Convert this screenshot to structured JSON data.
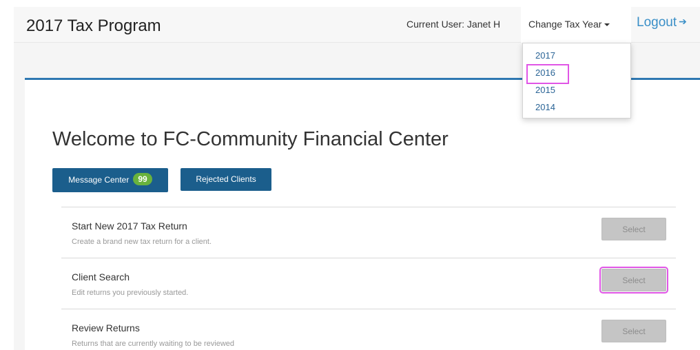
{
  "header": {
    "title": "2017 Tax Program",
    "current_user": "Current User: Janet H",
    "change_year_label": "Change Tax Year",
    "logout_label": "Logout",
    "logout_icon": "sign-out-icon"
  },
  "year_dropdown": {
    "items": [
      "2017",
      "2016",
      "2015",
      "2014"
    ],
    "highlighted": "2016"
  },
  "main": {
    "welcome": "Welcome to FC-Community Financial Center",
    "message_center_label": "Message Center",
    "message_count": "99",
    "rejected_clients_label": "Rejected Clients"
  },
  "options": [
    {
      "title": "Start New 2017 Tax Return",
      "description": "Create a brand new tax return for a client.",
      "button": "Select"
    },
    {
      "title": "Client Search",
      "description": "Edit returns you previously started.",
      "button": "Select"
    },
    {
      "title": "Review Returns",
      "description": "Returns that are currently waiting to be reviewed",
      "button": "Select"
    }
  ],
  "colors": {
    "primary_button": "#1b5e8c",
    "badge": "#69b23d",
    "accent": "#2e78b2",
    "link": "#3a8fc7",
    "highlight": "#e055e6"
  }
}
